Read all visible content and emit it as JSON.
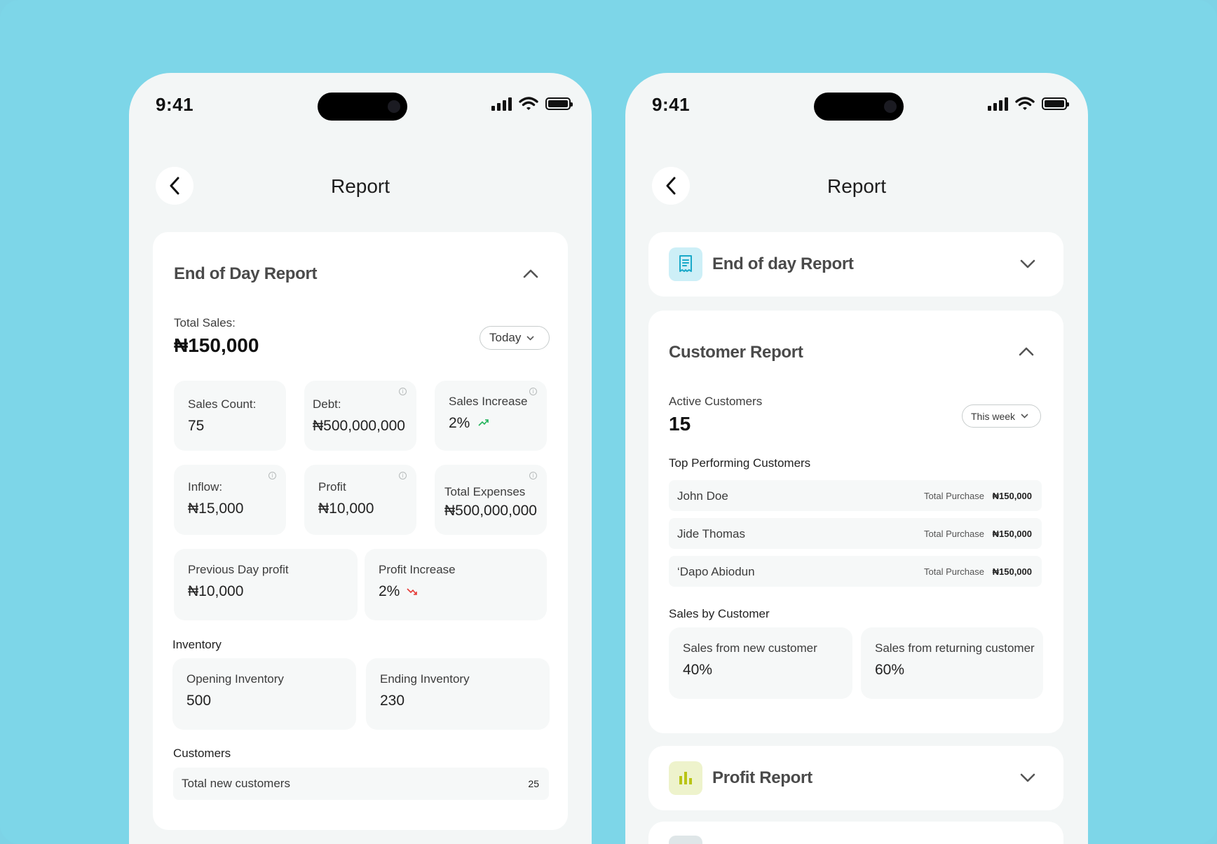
{
  "status": {
    "time": "9:41"
  },
  "left": {
    "page_title": "Report",
    "eod": {
      "title": "End of Day Report",
      "total_sales_label": "Total Sales:",
      "total_sales_value": "₦150,000",
      "period": "Today",
      "tiles": [
        {
          "label": "Sales Count:",
          "value": "75"
        },
        {
          "label": "Debt:",
          "value": "₦500,000,000"
        },
        {
          "label": "Sales Increase",
          "value": "2%"
        },
        {
          "label": "Inflow:",
          "value": "₦15,000"
        },
        {
          "label": "Profit",
          "value": "₦10,000"
        },
        {
          "label": "Total Expenses",
          "value": "₦500,000,000"
        },
        {
          "label": "Previous Day profit",
          "value": "₦10,000"
        },
        {
          "label": "Profit Increase",
          "value": "2%"
        }
      ],
      "inventory_label": "Inventory",
      "inventory": [
        {
          "label": "Opening Inventory",
          "value": "500"
        },
        {
          "label": "Ending Inventory",
          "value": "230"
        }
      ],
      "customers_label": "Customers",
      "new_customers_label": "Total new customers",
      "new_customers_value": "25"
    }
  },
  "right": {
    "page_title": "Report",
    "eod_title": "End of day Report",
    "customer": {
      "title": "Customer Report",
      "active_label": "Active Customers",
      "active_value": "15",
      "period": "This week",
      "top_label": "Top Performing Customers",
      "top": [
        {
          "name": "John Doe",
          "tp_label": "Total Purchase",
          "tp_value": "₦150,000"
        },
        {
          "name": "Jide Thomas",
          "tp_label": "Total Purchase",
          "tp_value": "₦150,000"
        },
        {
          "name": "‘Dapo Abiodun",
          "tp_label": "Total Purchase",
          "tp_value": "₦150,000"
        }
      ],
      "sales_by_label": "Sales by Customer",
      "split": [
        {
          "label": "Sales from new customer",
          "value": "40%"
        },
        {
          "label": "Sales from returning customer",
          "value": "60%"
        }
      ]
    },
    "profit_title": "Profit Report"
  },
  "colors": {
    "background": "#7dd6e8",
    "up": "#22b35a",
    "down": "#e53935",
    "eod_icon_bg": "#cdeff7",
    "eod_icon": "#1aa9c9",
    "profit_icon_bg": "#eef3cc",
    "profit_icon": "#b9c414"
  },
  "icons": [
    "back-arrow-icon",
    "chevron-up-icon",
    "chevron-down-icon",
    "info-icon",
    "trend-up-icon",
    "trend-down-icon",
    "receipt-icon",
    "bar-chart-icon",
    "signal-icon",
    "wifi-icon",
    "battery-icon"
  ]
}
